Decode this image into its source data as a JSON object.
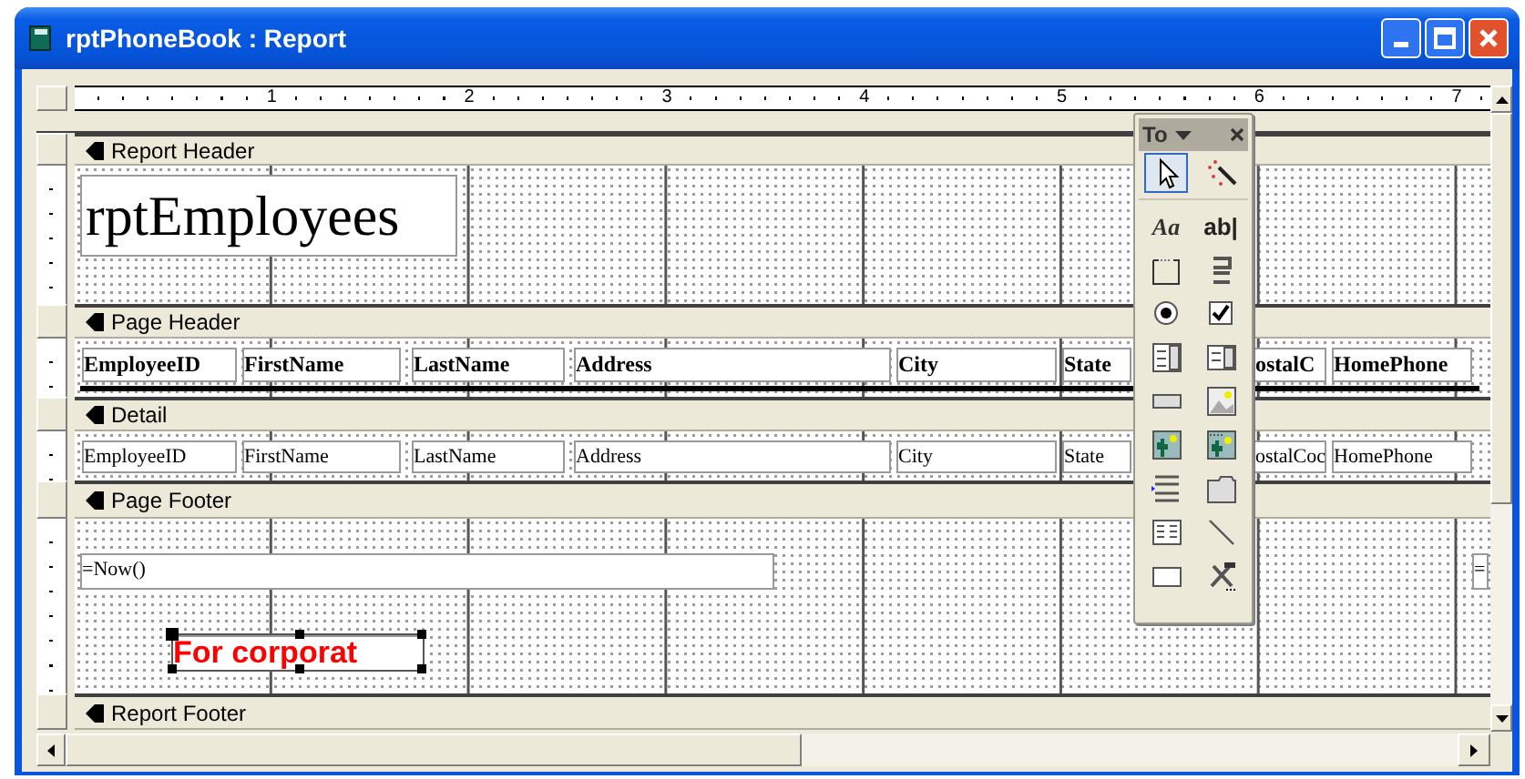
{
  "window": {
    "title": "rptPhoneBook : Report"
  },
  "ruler": {
    "numbers": [
      "1",
      "2",
      "3",
      "4",
      "5",
      "6",
      "7"
    ]
  },
  "sections": [
    {
      "kind": "report_header",
      "name": "Report Header",
      "controls": [
        {
          "kind": "title_label",
          "text": "rptEmployees",
          "color": "#000000",
          "selected": false
        }
      ]
    },
    {
      "kind": "page_header",
      "name": "Page Header",
      "controls": [
        {
          "kind": "label",
          "text": "EmployeeID",
          "color": "#000000",
          "selected": false
        },
        {
          "kind": "label",
          "text": "FirstName",
          "color": "#000000",
          "selected": false
        },
        {
          "kind": "label",
          "text": "LastName",
          "color": "#000000",
          "selected": false
        },
        {
          "kind": "label",
          "text": "Address",
          "color": "#000000",
          "selected": false
        },
        {
          "kind": "label",
          "text": "City",
          "color": "#000000",
          "selected": false
        },
        {
          "kind": "label",
          "text": "State",
          "color": "#000000",
          "selected": false
        },
        {
          "kind": "label",
          "text": "ostalC",
          "color": "#000000",
          "selected": false
        },
        {
          "kind": "label",
          "text": "HomePhone",
          "color": "#000000",
          "selected": false
        }
      ]
    },
    {
      "kind": "detail",
      "name": "Detail",
      "controls": [
        {
          "kind": "textbox",
          "text": "EmployeeID",
          "color": "#000000",
          "selected": false
        },
        {
          "kind": "textbox",
          "text": "FirstName",
          "color": "#000000",
          "selected": false
        },
        {
          "kind": "textbox",
          "text": "LastName",
          "color": "#000000",
          "selected": false
        },
        {
          "kind": "textbox",
          "text": "Address",
          "color": "#000000",
          "selected": false
        },
        {
          "kind": "textbox",
          "text": "City",
          "color": "#000000",
          "selected": false
        },
        {
          "kind": "textbox",
          "text": "State",
          "color": "#000000",
          "selected": false
        },
        {
          "kind": "textbox",
          "text": "ostalCoc",
          "color": "#000000",
          "selected": false
        },
        {
          "kind": "textbox",
          "text": "HomePhone",
          "color": "#000000",
          "selected": false
        }
      ]
    },
    {
      "kind": "page_footer",
      "name": "Page Footer",
      "controls": [
        {
          "kind": "textbox",
          "text": "=Now()",
          "color": "#000000",
          "selected": false
        },
        {
          "kind": "textbox",
          "text": "=",
          "color": "#000000",
          "selected": false
        },
        {
          "kind": "caption",
          "text": "For corporat",
          "color": "#ff0000",
          "selected": true
        }
      ]
    },
    {
      "kind": "report_footer",
      "name": "Report Footer"
    }
  ],
  "toolbox": {
    "title": "To",
    "tools": [
      {
        "kind": "pointer",
        "selected": true
      },
      {
        "kind": "wizard",
        "selected": false
      },
      {
        "kind": "label",
        "text": "Aa",
        "selected": false
      },
      {
        "kind": "textbox",
        "text": "ab|",
        "selected": false
      },
      {
        "kind": "option_group",
        "selected": false
      },
      {
        "kind": "toggle",
        "selected": false
      },
      {
        "kind": "option",
        "selected": false
      },
      {
        "kind": "checkbox",
        "selected": false
      },
      {
        "kind": "combo",
        "selected": false
      },
      {
        "kind": "list",
        "selected": false
      },
      {
        "kind": "command",
        "selected": false
      },
      {
        "kind": "image",
        "selected": false
      },
      {
        "kind": "unbound_frame",
        "selected": false
      },
      {
        "kind": "bound_frame",
        "selected": false
      },
      {
        "kind": "page_break",
        "selected": false
      },
      {
        "kind": "tab",
        "selected": false
      },
      {
        "kind": "subform",
        "selected": false
      },
      {
        "kind": "line",
        "selected": false
      },
      {
        "kind": "rectangle",
        "selected": false
      },
      {
        "kind": "more_tools",
        "selected": false
      }
    ]
  }
}
